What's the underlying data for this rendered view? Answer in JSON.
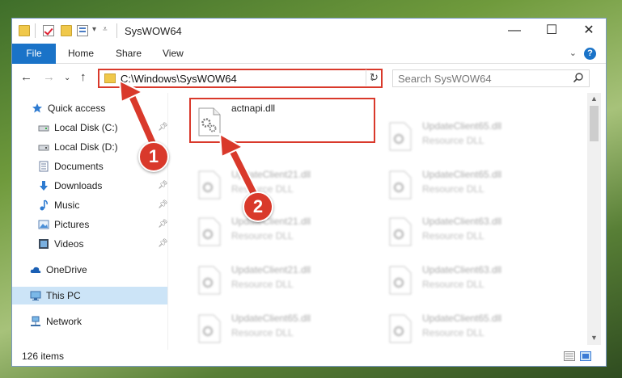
{
  "window": {
    "title": "SysWOW64",
    "minimize_glyph": "—",
    "maximize_glyph": "☐",
    "close_glyph": "✕"
  },
  "ribbon": {
    "tabs": [
      "File",
      "Home",
      "Share",
      "View"
    ],
    "help_glyph": "?"
  },
  "address": {
    "path": "C:\\Windows\\SysWOW64"
  },
  "search": {
    "placeholder": "Search SysWOW64"
  },
  "nav": {
    "items": [
      {
        "label": "Quick access",
        "icon": "star-icon",
        "pinned": false
      },
      {
        "label": "Local Disk (C:)",
        "icon": "drive-icon",
        "pinned": true
      },
      {
        "label": "Local Disk (D:)",
        "icon": "drive-icon",
        "pinned": false
      },
      {
        "label": "Documents",
        "icon": "documents-icon",
        "pinned": true
      },
      {
        "label": "Downloads",
        "icon": "download-icon",
        "pinned": true
      },
      {
        "label": "Music",
        "icon": "music-icon",
        "pinned": true
      },
      {
        "label": "Pictures",
        "icon": "pictures-icon",
        "pinned": true
      },
      {
        "label": "Videos",
        "icon": "videos-icon",
        "pinned": true
      },
      {
        "label": "OneDrive",
        "icon": "cloud-icon",
        "pinned": false
      },
      {
        "label": "This PC",
        "icon": "computer-icon",
        "pinned": false,
        "selected": true
      },
      {
        "label": "Network",
        "icon": "network-icon",
        "pinned": false
      }
    ]
  },
  "files": {
    "left": [
      {
        "name": "actnapi.dll",
        "type": "",
        "highlighted": true
      },
      {
        "name": "UpdateClient21.dll",
        "type": "Resource DLL"
      },
      {
        "name": "UpdateClient21.dll",
        "type": "Resource DLL"
      },
      {
        "name": "UpdateClient21.dll",
        "type": "Resource DLL"
      },
      {
        "name": "UpdateClient65.dll",
        "type": "Resource DLL"
      }
    ],
    "right": [
      {
        "name": "UpdateClient65.dll",
        "type": "Resource DLL"
      },
      {
        "name": "UpdateClient65.dll",
        "type": "Resource DLL"
      },
      {
        "name": "UpdateClient63.dll",
        "type": "Resource DLL"
      },
      {
        "name": "UpdateClient63.dll",
        "type": "Resource DLL"
      },
      {
        "name": "UpdateClient65.dll",
        "type": "Resource DLL"
      }
    ]
  },
  "status": {
    "item_count": "126 items"
  },
  "callouts": {
    "step1": "1",
    "step2": "2",
    "color": "#d9392b"
  },
  "colors": {
    "accent": "#1a73c8",
    "selection": "#cce4f7",
    "highlight": "#d9392b"
  }
}
